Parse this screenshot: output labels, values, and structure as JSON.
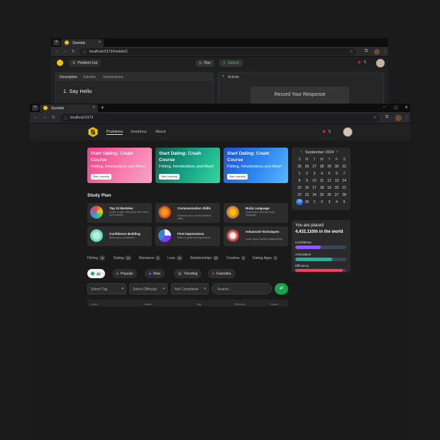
{
  "back_window": {
    "tab_title": "Stumble",
    "url": "localhost:5173/module/1",
    "problem_list": "Problem List",
    "run": "Run",
    "submit": "Submit",
    "streak": "5",
    "tabs": [
      "Description",
      "Solution",
      "Submissions"
    ],
    "problem_title": "1. Say Hello",
    "activity": "Activity",
    "record_button": "Record Your Response"
  },
  "front_window": {
    "tab_title": "Stumble",
    "url": "localhost:5173",
    "nav": {
      "problems": "Problems",
      "solutions": "Solutions",
      "about": "About"
    },
    "streak": "5",
    "banners": [
      {
        "title": "Start Dating: Crash Course",
        "subtitle": "Flirting, Introductions and More!",
        "button": "Start Learning"
      },
      {
        "title": "Start Dating: Crash Course",
        "subtitle": "Flirting, Introductions and More!",
        "button": "Start Learning"
      },
      {
        "title": "Start Dating: Crash Course",
        "subtitle": "Flirting, Introductions and More!",
        "button": "Start Learning"
      }
    ],
    "study_plan_title": "Study Plan",
    "study_plan": [
      {
        "title": "Top 10 Modules",
        "desc": "Learn to date effectively with these top modules.",
        "icon": "colorful-grid-icon"
      },
      {
        "title": "Communication Skills",
        "desc": "Enhance your communication skills.",
        "icon": "communication-icon"
      },
      {
        "title": "Body Language",
        "desc": "Understand and use body language.",
        "icon": "body-language-icon"
      },
      {
        "title": "Confidence Building",
        "desc": "Boost your confidence.",
        "icon": "confidence-icon"
      },
      {
        "title": "First Impressions",
        "desc": "Make a great first impression.",
        "icon": "first-impressions-icon"
      },
      {
        "title": "Advanced Techniques",
        "desc": "Learn about lasting relationships.",
        "icon": "advanced-icon"
      }
    ],
    "topics": [
      {
        "label": "Flirting",
        "count": "10"
      },
      {
        "label": "Dating",
        "count": "15"
      },
      {
        "label": "Romance",
        "count": "8"
      },
      {
        "label": "Love",
        "count": "12"
      },
      {
        "label": "Relationships",
        "count": "20"
      },
      {
        "label": "Crushes",
        "count": "5"
      },
      {
        "label": "Dating Apps",
        "count": "7"
      }
    ],
    "filters": [
      "All",
      "Popular",
      "New",
      "Trending",
      "Favorites"
    ],
    "selects": {
      "tag": "Select Tag",
      "difficulty": "Select Difficulty",
      "status": "Not Completed",
      "search_placeholder": "Search..."
    },
    "table_headers": [
      "Index",
      "Name",
      "Tag",
      "Difficulty",
      "Status"
    ],
    "calendar": {
      "month": "September 2024",
      "weekdays": [
        "S",
        "M",
        "T",
        "W",
        "T",
        "F",
        "S"
      ],
      "days": [
        [
          "25",
          "26",
          "27",
          "28",
          "29",
          "30",
          "31"
        ],
        [
          "1",
          "2",
          "3",
          "4",
          "5",
          "6",
          "7"
        ],
        [
          "8",
          "9",
          "10",
          "11",
          "12",
          "13",
          "14"
        ],
        [
          "15",
          "16",
          "17",
          "18",
          "19",
          "20",
          "21"
        ],
        [
          "22",
          "23",
          "24",
          "25",
          "26",
          "27",
          "28"
        ],
        [
          "29",
          "30",
          "1",
          "2",
          "3",
          "4",
          "5"
        ]
      ],
      "today": "29"
    },
    "stats": {
      "heading": "You are placed",
      "rank": "4,432,110th in the world",
      "metrics": [
        {
          "label": "Confidence",
          "value": 0.5,
          "color": "#8b5cf6"
        },
        {
          "label": "Articulation",
          "value": 0.72,
          "color": "#14b8a6"
        },
        {
          "label": "Efficiency",
          "value": 0.93,
          "color": "#f43f5e"
        }
      ]
    }
  }
}
